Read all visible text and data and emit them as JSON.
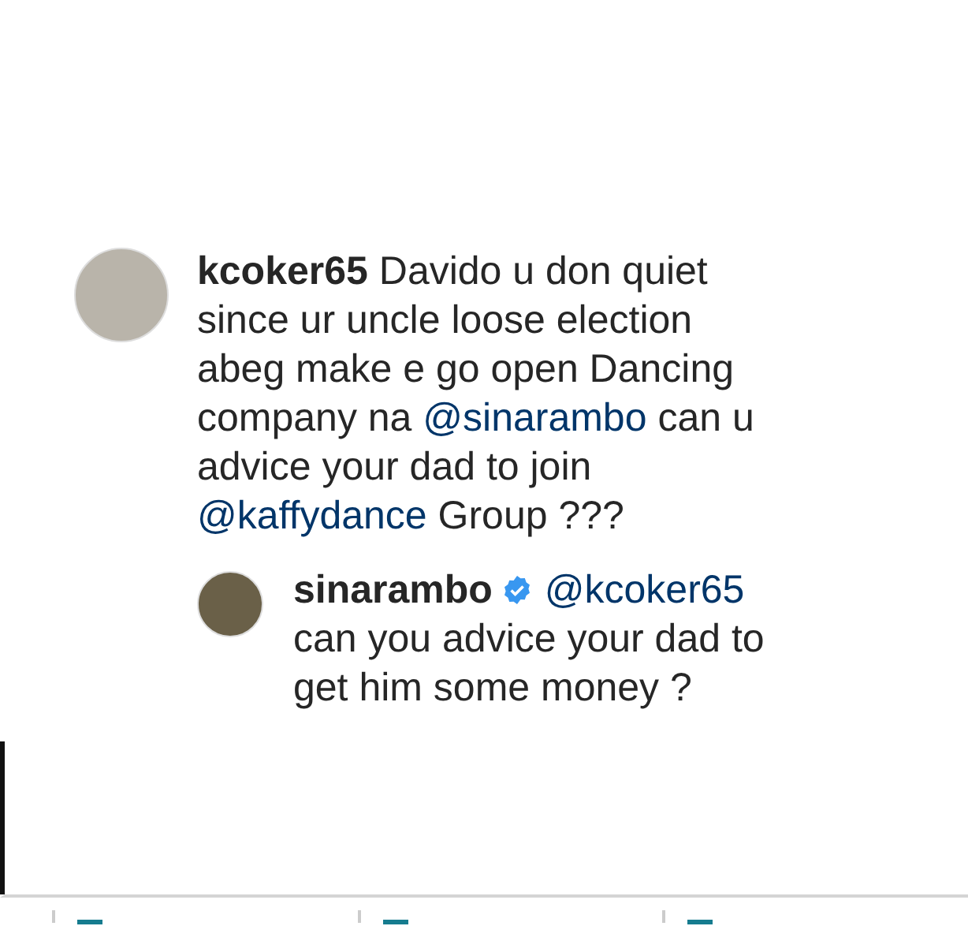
{
  "comments": [
    {
      "username": "kcoker65",
      "verified": false,
      "reply": false,
      "body": [
        {
          "kind": "text",
          "text": "Davido u don quiet since ur uncle loose election abeg make e go open Dancing company na "
        },
        {
          "kind": "mention",
          "text": "@sinarambo"
        },
        {
          "kind": "text",
          "text": " can u advice your dad to join "
        },
        {
          "kind": "mention",
          "text": "@kaffydance"
        },
        {
          "kind": "text",
          "text": " Group ???"
        }
      ]
    },
    {
      "username": "sinarambo",
      "verified": true,
      "reply": true,
      "body": [
        {
          "kind": "mention",
          "text": "@kcoker65"
        },
        {
          "kind": "text",
          "text": " can you advice your dad to get him some money ?"
        }
      ]
    }
  ]
}
